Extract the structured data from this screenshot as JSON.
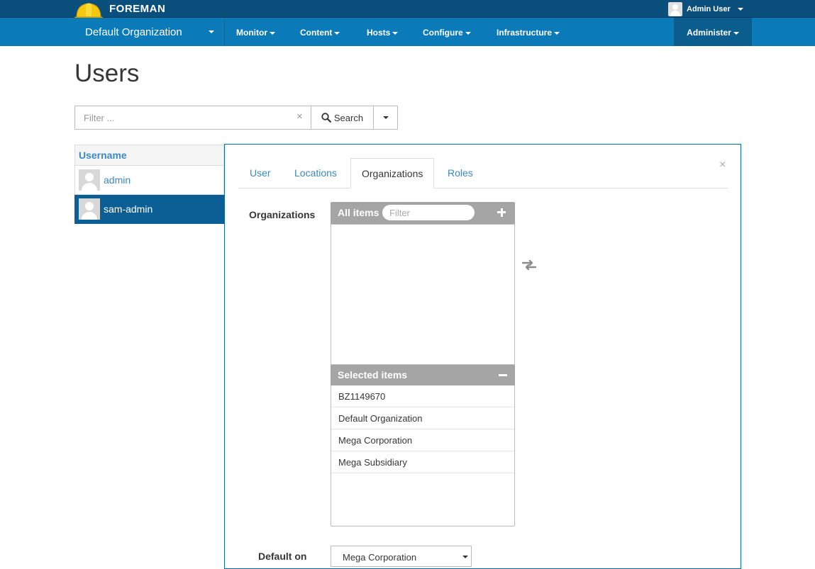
{
  "brand": {
    "name": "FOREMAN",
    "logo_icon": "hardhat-icon"
  },
  "user_menu": {
    "name": "Admin User"
  },
  "navbar": {
    "org_switcher": "Default Organization",
    "items": [
      "Monitor",
      "Content",
      "Hosts",
      "Configure",
      "Infrastructure"
    ],
    "admin": "Administer"
  },
  "page": {
    "title": "Users"
  },
  "search": {
    "placeholder": "Filter ...",
    "clear": "×",
    "button_label": "Search"
  },
  "users_table": {
    "column_header": "Username",
    "rows": [
      {
        "username": "admin",
        "selected": false
      },
      {
        "username": "sam-admin",
        "selected": true
      }
    ]
  },
  "edit_panel": {
    "close": "×",
    "tabs": [
      "User",
      "Locations",
      "Organizations",
      "Roles"
    ],
    "active_tab": "Organizations",
    "field_label": "Organizations",
    "all_items": {
      "label": "All items",
      "filter_placeholder": "Filter"
    },
    "selected_items": {
      "label": "Selected items",
      "items": [
        "BZ1149670",
        "Default Organization",
        "Mega Corporation",
        "Mega Subsidiary"
      ]
    },
    "default_field": {
      "label": "Default on",
      "value": "Mega Corporation"
    }
  },
  "colors": {
    "topbar": "#0b4f7c",
    "navbar": "#0a7ab8",
    "selected_row": "#0b5f95",
    "link": "#3b89c1",
    "list_header": "#a5a5a5"
  }
}
